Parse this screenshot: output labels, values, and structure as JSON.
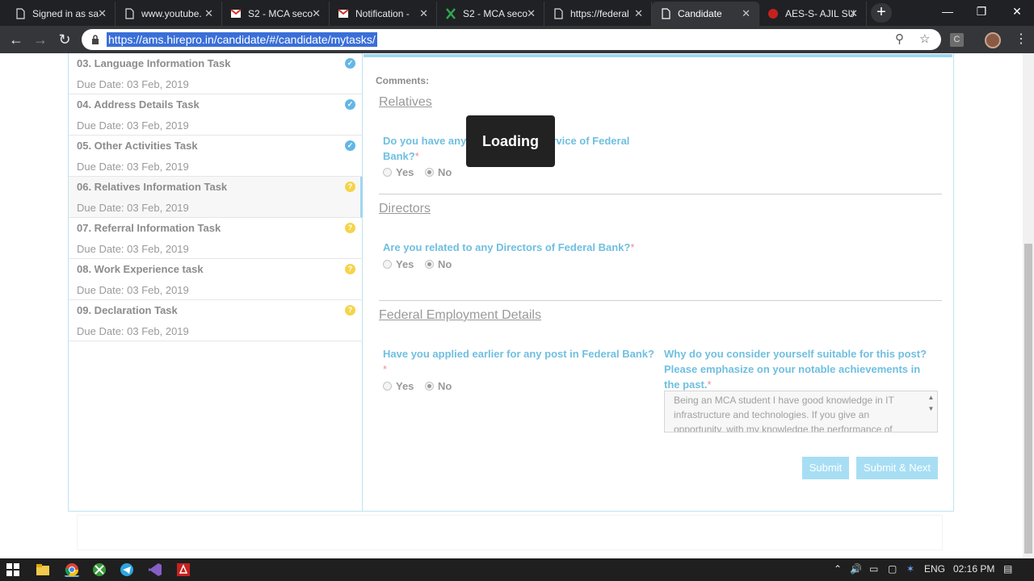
{
  "browser": {
    "tabs": [
      {
        "title": "Signed in as sa",
        "icon": "page-icon",
        "active": false
      },
      {
        "title": "www.youtube.",
        "icon": "page-icon",
        "active": false
      },
      {
        "title": "S2 - MCA seco",
        "icon": "gmail-icon",
        "active": false
      },
      {
        "title": "Notification - ",
        "icon": "gmail-icon",
        "active": false
      },
      {
        "title": "S2 - MCA seco",
        "icon": "excel-icon",
        "active": false
      },
      {
        "title": "https://federal",
        "icon": "page-icon",
        "active": false
      },
      {
        "title": "Candidate",
        "icon": "page-icon",
        "active": true
      },
      {
        "title": "AES-S- AJIL SU",
        "icon": "pdf-icon",
        "active": false
      }
    ],
    "url": "https://ams.hirepro.in/candidate/#/candidate/mytasks/",
    "close_glyph": "✕",
    "new_tab_glyph": "+"
  },
  "tasks": [
    {
      "name": "03. Language Information Task",
      "due": "Due Date: 03 Feb, 2019",
      "status": "done"
    },
    {
      "name": "04. Address Details Task",
      "due": "Due Date: 03 Feb, 2019",
      "status": "done"
    },
    {
      "name": "05. Other Activities Task",
      "due": "Due Date: 03 Feb, 2019",
      "status": "done"
    },
    {
      "name": "06. Relatives Information Task",
      "due": "Due Date: 03 Feb, 2019",
      "status": "pending"
    },
    {
      "name": "07. Referral Information Task",
      "due": "Due Date: 03 Feb, 2019",
      "status": "pending"
    },
    {
      "name": "08. Work Experience task",
      "due": "Due Date: 03 Feb, 2019",
      "status": "pending"
    },
    {
      "name": "09. Declaration Task",
      "due": "Due Date: 03 Feb, 2019",
      "status": "pending"
    }
  ],
  "form": {
    "comments_label": "Comments:",
    "relatives": {
      "title": "Relatives",
      "question_part1": "Do you have any",
      "question_part2": "rvice of Federal",
      "question_line2": "Bank?",
      "yes": "Yes",
      "no": "No",
      "selected": "No"
    },
    "directors": {
      "title": "Directors",
      "question": "Are you related to any Directors of Federal Bank?",
      "yes": "Yes",
      "no": "No",
      "selected": "No"
    },
    "employment": {
      "title": "Federal Employment Details",
      "applied_question": "Have you applied earlier for any post in Federal Bank?",
      "yes": "Yes",
      "no": "No",
      "selected": "No",
      "suitable_question_line1": "Why do you consider yourself suitable for this post?",
      "suitable_question_line2": "Please emphasize on your notable achievements in",
      "suitable_question_line3": "the past.",
      "answer": "Being an MCA student I have good knowledge in IT infrastructure  and technologies. If you give an opportunity, with my knowledge the performance of"
    },
    "required_marker": "*",
    "submit_label": "Submit",
    "submit_next_label": "Submit & Next"
  },
  "overlay": {
    "loading_text": "Loading"
  },
  "system": {
    "lang": "ENG",
    "time": "02:16 PM"
  }
}
